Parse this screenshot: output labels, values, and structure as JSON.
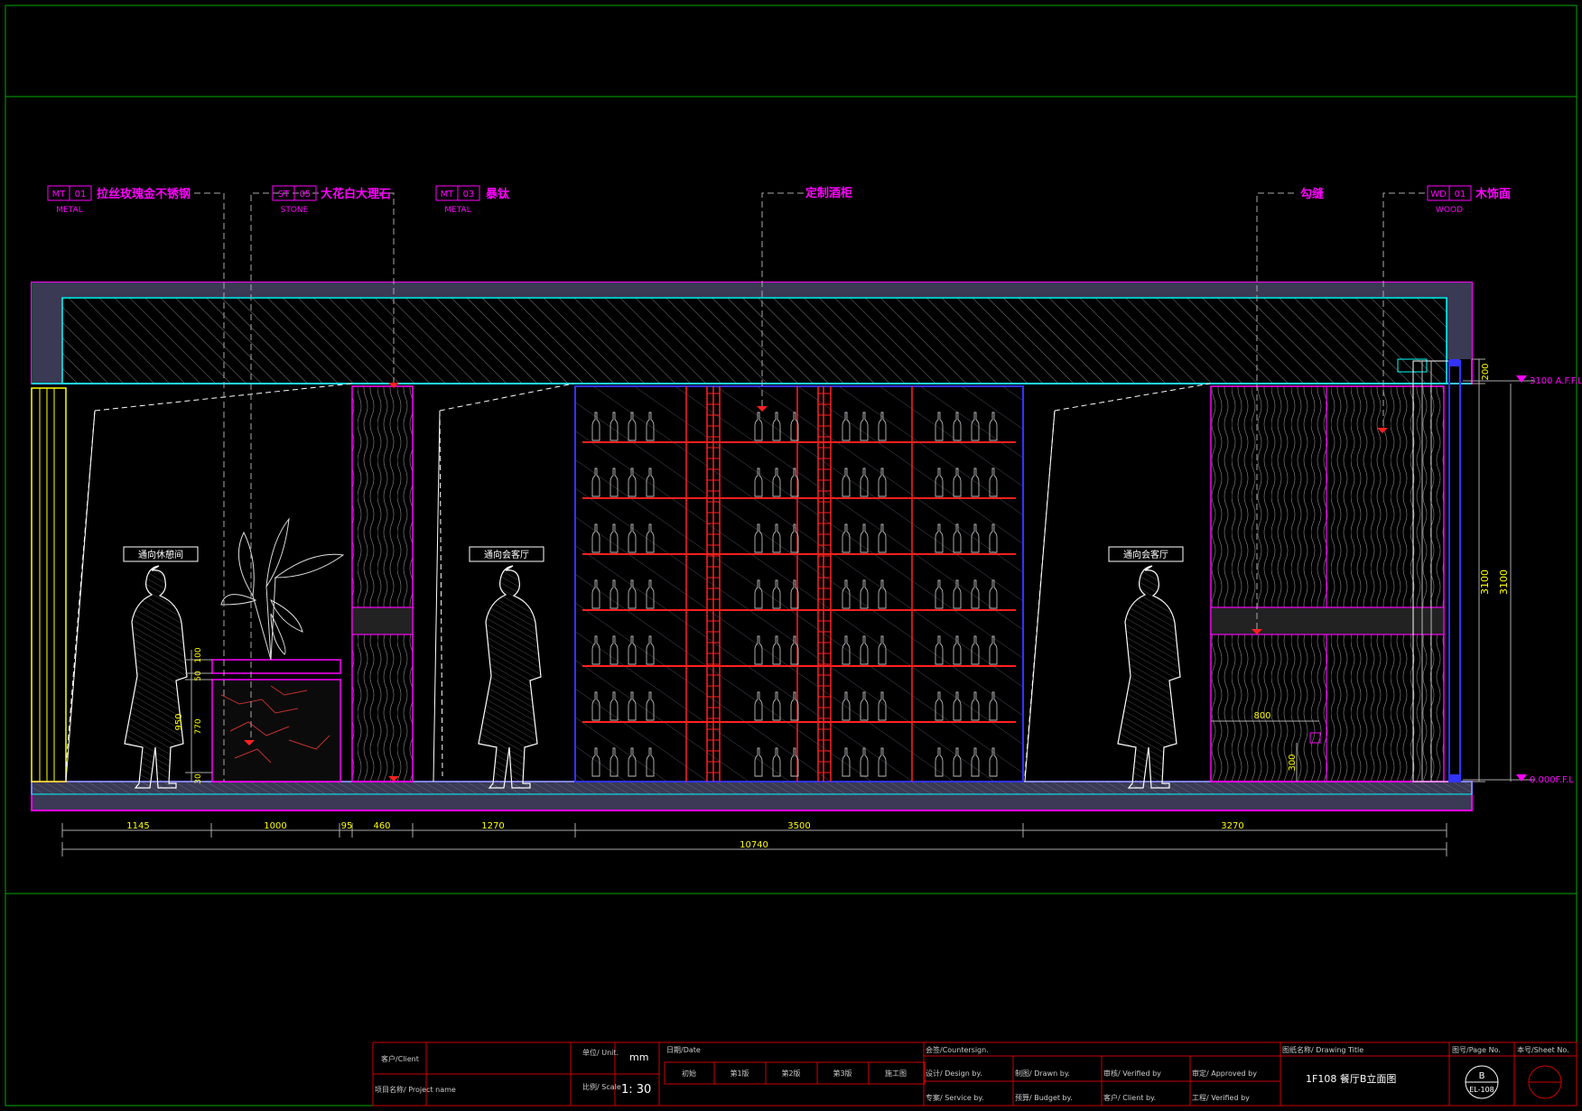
{
  "callouts": [
    {
      "code": "MT",
      "num": "01",
      "label": "拉丝玫瑰金不锈钢",
      "sub": "METAL"
    },
    {
      "code": "ST",
      "num": "05",
      "label": "大花白大理石",
      "sub": "STONE"
    },
    {
      "code": "MT",
      "num": "03",
      "label": "暴钛",
      "sub": "METAL"
    },
    {
      "code": "",
      "num": "",
      "label": "定制酒柜",
      "sub": ""
    },
    {
      "code": "",
      "num": "",
      "label": "勾缝",
      "sub": ""
    },
    {
      "code": "WD",
      "num": "01",
      "label": "木饰面",
      "sub": "WOOD"
    }
  ],
  "signs": [
    "通向休憩间",
    "通向会客厅",
    "通向会客厅"
  ],
  "levels": {
    "top": "3100 A.F.F.L",
    "bottom": "0.000F.F.L"
  },
  "vertical_dims": {
    "h200": "200",
    "h3100_a": "3100",
    "h3100_b": "3100"
  },
  "planter_dims": [
    "100",
    "50",
    "950",
    "770",
    "30"
  ],
  "cabinet_dims": {
    "w800": "800",
    "h300": "300"
  },
  "bottom_dims": {
    "segments": [
      "1145",
      "1000",
      "95",
      "460",
      "1270",
      "3500",
      "3270"
    ],
    "total": "10740"
  },
  "title_block": {
    "client_label": "客户/Client",
    "project_label": "项目名称/ Project name",
    "unit_label": "单位/ Unit.",
    "unit_value": "mm",
    "scale_label": "比例/ Scale",
    "scale_value": "1: 30",
    "date_label": "日期/Date",
    "stages": [
      "初始",
      "第1版",
      "第2版",
      "第3版",
      "施工图"
    ],
    "countersign_label": "会签/Countersign.",
    "design_label": "设计/ Design by.",
    "service_label": "专案/ Service by.",
    "drawn_label": "制图/ Drawn by.",
    "budget_label": "预算/ Budget by.",
    "verified_label": "审核/ Verified by",
    "client_by_label": "客户/ Client by.",
    "approved_label": "审定/ Approved by",
    "verified2_label": "工程/ Verified by",
    "drawing_title_label": "图纸名称/  Drawing Title",
    "drawing_title": "1F108 餐厅B立面图",
    "page_label": "图号/Page No.",
    "page_no_top": "B",
    "page_no_bottom": "EL-108",
    "sheet_label": "本号/Sheet No."
  },
  "colors": {
    "magenta": "#ff00ff",
    "cyan": "#00ffff",
    "red": "#ff2020",
    "yellow": "#ffff00",
    "blue": "#3333ff",
    "green": "#00aa00",
    "white": "#ffffff",
    "gray": "#a0a0a0"
  }
}
